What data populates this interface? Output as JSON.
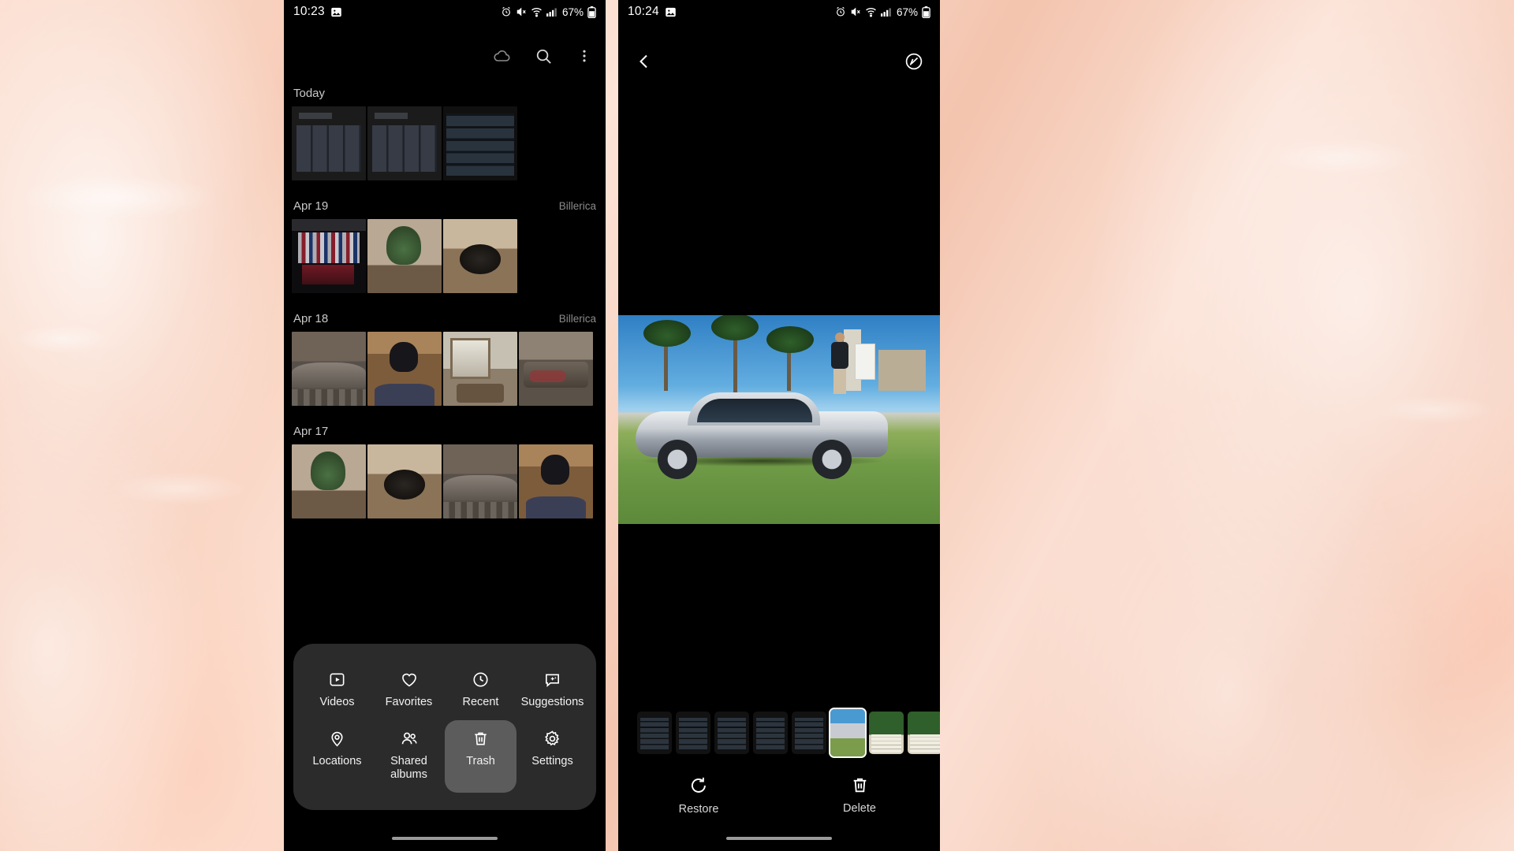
{
  "left_phone": {
    "status_bar": {
      "time": "10:23",
      "battery_percent": "67%",
      "icons": [
        "image-icon",
        "alarm-icon",
        "mute-icon",
        "wifi-icon",
        "signal-icon",
        "battery-icon"
      ]
    },
    "top_bar": {
      "cloud_label": "cloud-icon",
      "search_label": "search-icon",
      "more_label": "more-options-icon"
    },
    "sections": [
      {
        "date": "Today",
        "location": ""
      },
      {
        "date": "Apr 19",
        "location": "Billerica"
      },
      {
        "date": "Apr 18",
        "location": "Billerica"
      },
      {
        "date": "Apr 17",
        "location": ""
      }
    ],
    "menu": {
      "row1": [
        {
          "label": "Videos",
          "icon": "video-icon",
          "selected": false
        },
        {
          "label": "Favorites",
          "icon": "heart-icon",
          "selected": false
        },
        {
          "label": "Recent",
          "icon": "clock-icon",
          "selected": false
        },
        {
          "label": "Suggestions",
          "icon": "suggestions-icon",
          "selected": false
        }
      ],
      "row2": [
        {
          "label": "Locations",
          "icon": "location-pin-icon",
          "selected": false
        },
        {
          "label": "Shared albums",
          "icon": "people-icon",
          "selected": false
        },
        {
          "label": "Trash",
          "icon": "trash-icon",
          "selected": true
        },
        {
          "label": "Settings",
          "icon": "gear-icon",
          "selected": false
        }
      ]
    }
  },
  "right_phone": {
    "status_bar": {
      "time": "10:24",
      "battery_percent": "67%",
      "icons": [
        "image-icon",
        "alarm-icon",
        "mute-icon",
        "wifi-icon",
        "signal-icon",
        "battery-icon"
      ]
    },
    "viewer": {
      "back_label": "back-icon",
      "info_label": "image-info-icon",
      "photo_description": "Silver Toyota Prius parked on grass with palm trees and a person standing nearby"
    },
    "actions": [
      {
        "label": "Restore",
        "icon": "restore-icon"
      },
      {
        "label": "Delete",
        "icon": "trash-icon"
      }
    ]
  },
  "colors": {
    "background_peach": "#f7cdb9",
    "phone_black": "#000000",
    "sheet_gray": "#2b2b2b",
    "selected_gray": "#5c5c5c",
    "text_primary": "#f1f1f1",
    "text_secondary": "#8a8a8a"
  }
}
